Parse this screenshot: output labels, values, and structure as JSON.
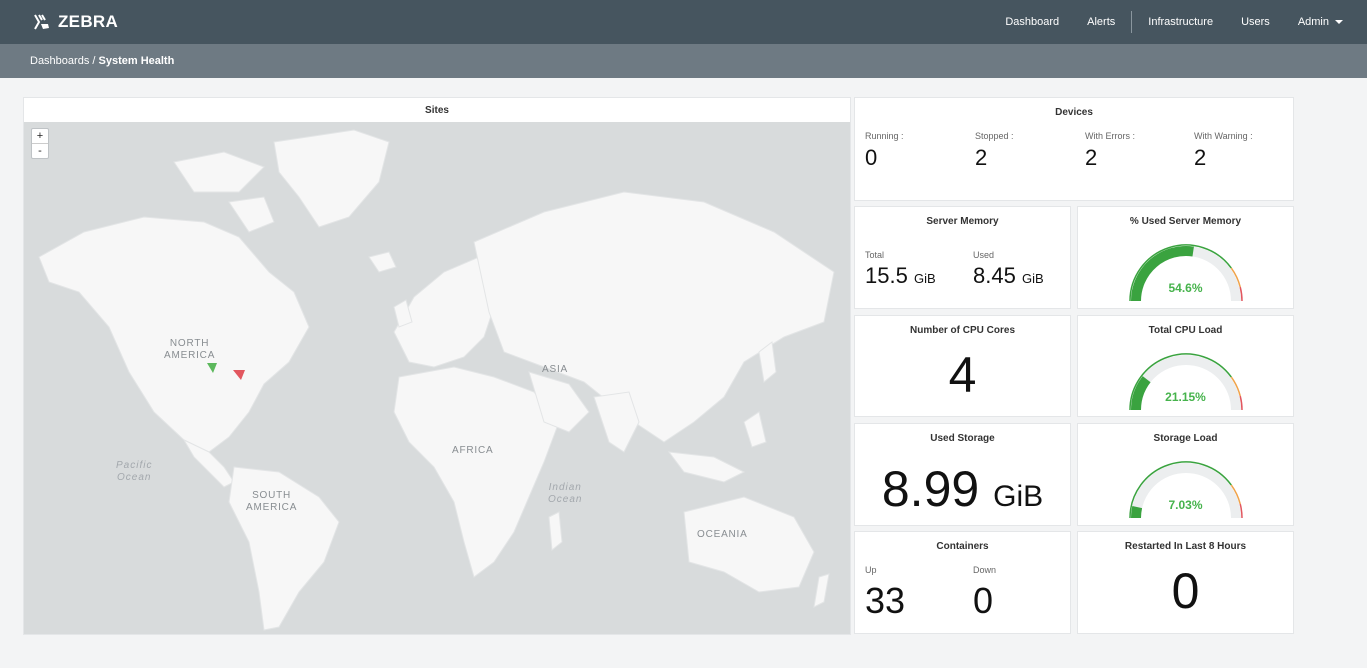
{
  "app": {
    "brand": "ZEBRA",
    "nav": [
      "Dashboard",
      "Alerts",
      "Infrastructure",
      "Users"
    ],
    "admin_label": "Admin"
  },
  "breadcrumb": {
    "parent": "Dashboards",
    "separator": " / ",
    "current": "System Health"
  },
  "sites": {
    "title": "Sites",
    "zoom_in": "+",
    "zoom_out": "-",
    "labels": {
      "north_america": "NORTH\nAMERICA",
      "south_america": "SOUTH\nAMERICA",
      "africa": "AFRICA",
      "asia": "ASIA",
      "oceania": "OCEANIA",
      "pacific": "Pacific\nOcean",
      "indian": "Indian\nOcean"
    },
    "markers": [
      {
        "status": "ok",
        "color": "#5cb85c"
      },
      {
        "status": "error",
        "color": "#e2575f"
      }
    ]
  },
  "devices": {
    "title": "Devices",
    "running_label": "Running :",
    "running": "0",
    "stopped_label": "Stopped :",
    "stopped": "2",
    "errors_label": "With Errors :",
    "errors": "2",
    "warning_label": "With Warning :",
    "warning": "2"
  },
  "server_memory": {
    "title": "Server Memory",
    "total_label": "Total",
    "total": "15.5",
    "total_unit": "GiB",
    "used_label": "Used",
    "used": "8.45",
    "used_unit": "GiB"
  },
  "used_memory_gauge": {
    "title": "% Used Server Memory",
    "value": 54.6,
    "label": "54.6%"
  },
  "cpu_cores": {
    "title": "Number of CPU Cores",
    "value": "4"
  },
  "cpu_load_gauge": {
    "title": "Total CPU Load",
    "value": 21.15,
    "label": "21.15%"
  },
  "used_storage": {
    "title": "Used Storage",
    "value": "8.99",
    "unit": "GiB"
  },
  "storage_load_gauge": {
    "title": "Storage Load",
    "value": 7.03,
    "label": "7.03%"
  },
  "containers": {
    "title": "Containers",
    "up_label": "Up",
    "up": "33",
    "down_label": "Down",
    "down": "0"
  },
  "restarted": {
    "title": "Restarted In Last 8 Hours",
    "value": "0"
  },
  "colors": {
    "topbar": "#46555f",
    "breadbar": "#6e7a83",
    "gauge_green": "#3aa33f",
    "gauge_orange": "#f0a34a",
    "gauge_red": "#e2575f",
    "gauge_track": "#eceeef"
  }
}
